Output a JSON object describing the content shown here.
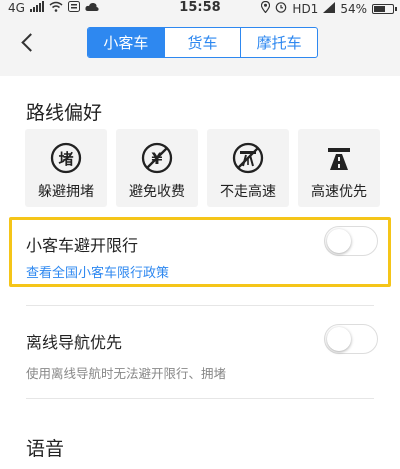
{
  "status": {
    "network": "4G",
    "time": "15:58",
    "carrier": "HD1",
    "battery": "54%",
    "battery_level": 0.54
  },
  "header": {
    "tabs": [
      {
        "label": "小客车",
        "active": true
      },
      {
        "label": "货车",
        "active": false
      },
      {
        "label": "摩托车",
        "active": false
      }
    ]
  },
  "route": {
    "section_title": "路线偏好",
    "prefs": [
      {
        "label": "躲避拥堵",
        "icon": "avoid-congestion-icon"
      },
      {
        "label": "避免收费",
        "icon": "avoid-toll-icon"
      },
      {
        "label": "不走高速",
        "icon": "no-highway-icon"
      },
      {
        "label": "高速优先",
        "icon": "highway-priority-icon"
      }
    ]
  },
  "restriction": {
    "title": "小客车避开限行",
    "link": "查看全国小客车限行政策",
    "enabled": false
  },
  "offline": {
    "title": "离线导航优先",
    "subtitle": "使用离线导航时无法避开限行、拥堵",
    "enabled": false
  },
  "voice": {
    "section_title": "语音"
  },
  "colors": {
    "accent": "#2e88f0",
    "highlight": "#f5c518"
  }
}
